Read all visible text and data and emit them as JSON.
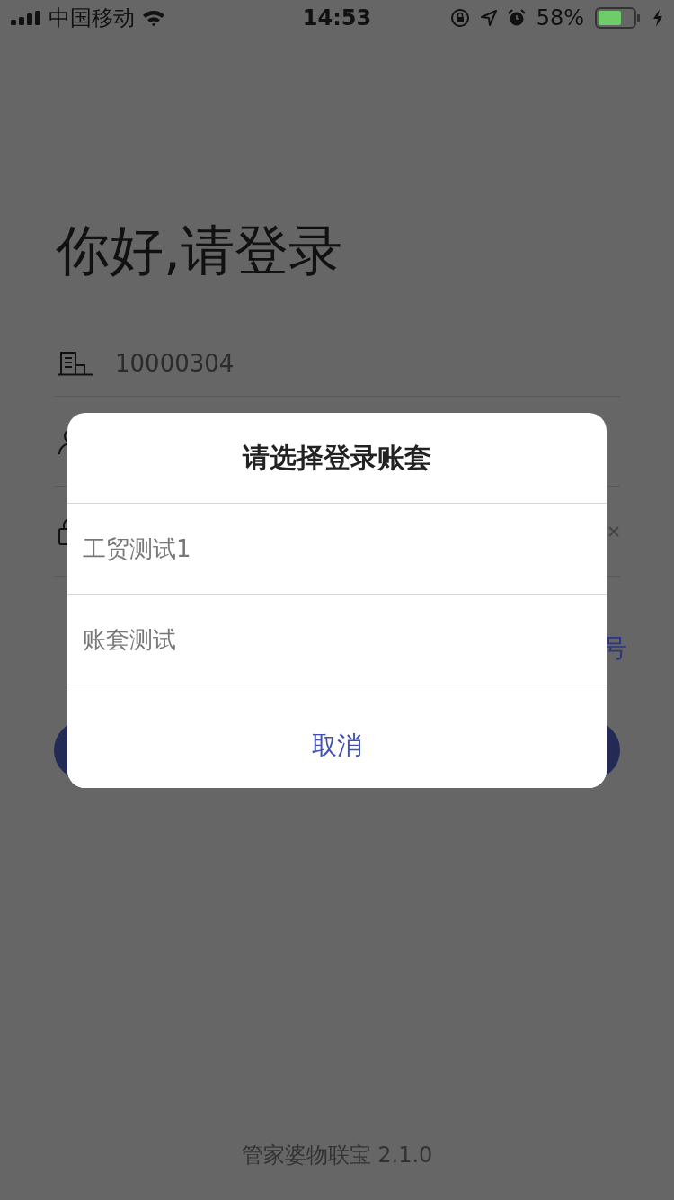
{
  "status_bar": {
    "carrier": "中国移动",
    "time": "14:53",
    "battery_percent": "58%"
  },
  "login": {
    "heading": "你好,请登录",
    "account_value": "10000304",
    "link_fragment": "号"
  },
  "dialog": {
    "title": "请选择登录账套",
    "options": [
      {
        "label": "工贸测试1"
      },
      {
        "label": "账套测试"
      }
    ],
    "cancel": "取消"
  },
  "footer": "管家婆物联宝 2.1.0"
}
